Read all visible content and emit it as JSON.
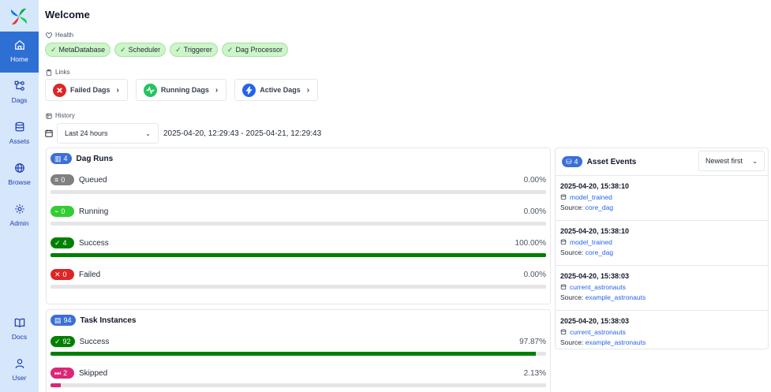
{
  "sidebar": {
    "items": [
      {
        "label": "Home",
        "icon": "home-icon"
      },
      {
        "label": "Dags",
        "icon": "dags-icon"
      },
      {
        "label": "Assets",
        "icon": "database-icon"
      },
      {
        "label": "Browse",
        "icon": "globe-icon"
      },
      {
        "label": "Admin",
        "icon": "gear-icon"
      },
      {
        "label": "Docs",
        "icon": "book-icon"
      },
      {
        "label": "User",
        "icon": "user-icon"
      }
    ]
  },
  "page": {
    "title": "Welcome",
    "health_label": "Health",
    "links_label": "Links",
    "history_label": "History"
  },
  "health": [
    "MetaDatabase",
    "Scheduler",
    "Triggerer",
    "Dag Processor"
  ],
  "links": [
    {
      "label": "Failed Dags",
      "color": "#dc2626"
    },
    {
      "label": "Running Dags",
      "color": "#22c55e"
    },
    {
      "label": "Active Dags",
      "color": "#2563eb"
    }
  ],
  "history": {
    "range_option": "Last 24 hours",
    "range_text": "2025-04-20, 12:29:43 - 2025-04-21, 12:29:43"
  },
  "dag_runs": {
    "title": "Dag Runs",
    "count": "4",
    "states": [
      {
        "label": "Queued",
        "count": "0",
        "pct": "0.00%",
        "fraction": 0,
        "color": "#808080"
      },
      {
        "label": "Running",
        "count": "0",
        "pct": "0.00%",
        "fraction": 0,
        "color": "#32cd32"
      },
      {
        "label": "Success",
        "count": "4",
        "pct": "100.00%",
        "fraction": 1.0,
        "color": "#008000"
      },
      {
        "label": "Failed",
        "count": "0",
        "pct": "0.00%",
        "fraction": 0,
        "color": "#dc2626"
      }
    ]
  },
  "task_instances": {
    "title": "Task Instances",
    "count": "94",
    "states": [
      {
        "label": "Success",
        "count": "92",
        "pct": "97.87%",
        "fraction": 0.9787,
        "color": "#008000"
      },
      {
        "label": "Skipped",
        "count": "2",
        "pct": "2.13%",
        "fraction": 0.0213,
        "color": "#db2777"
      }
    ]
  },
  "asset_events": {
    "title": "Asset Events",
    "count": "4",
    "sort": "Newest first",
    "source_label": "Source:",
    "events": [
      {
        "time": "2025-04-20, 15:38:10",
        "asset": "model_trained",
        "source": "core_dag"
      },
      {
        "time": "2025-04-20, 15:38:10",
        "asset": "model_trained",
        "source": "core_dag"
      },
      {
        "time": "2025-04-20, 15:38:03",
        "asset": "current_astronauts",
        "source": "example_astronauts"
      },
      {
        "time": "2025-04-20, 15:38:03",
        "asset": "current_astronauts",
        "source": "example_astronauts"
      }
    ]
  }
}
